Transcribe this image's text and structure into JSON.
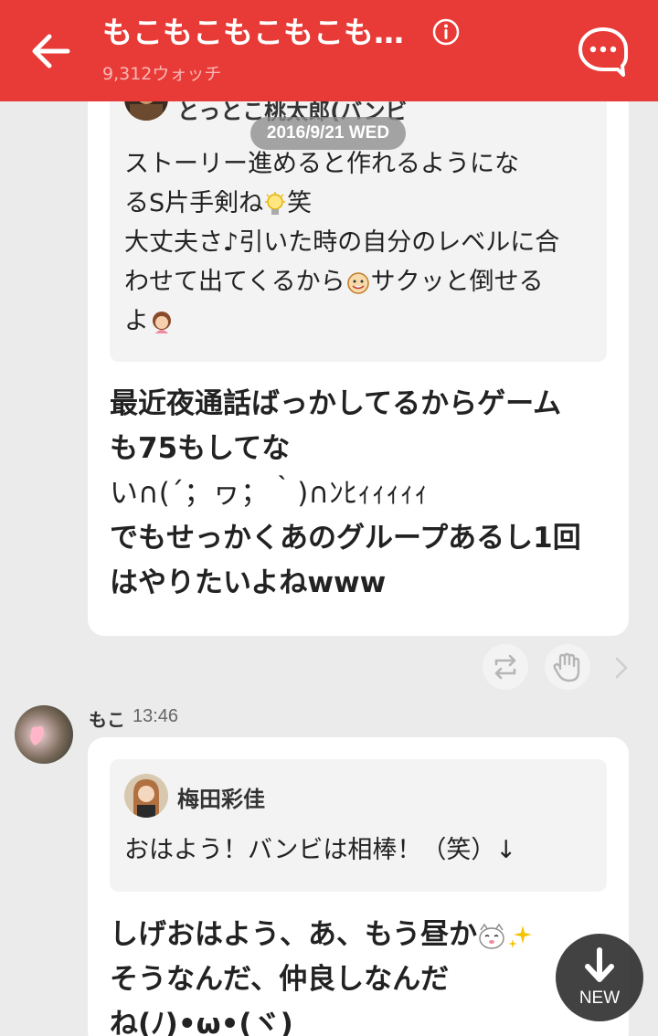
{
  "header": {
    "title": "もこもこもこもこも…",
    "subtitle": "9,312ウォッチ",
    "accent": "#e83a36"
  },
  "date_separator": "2016/9/21 WED",
  "messages": [
    {
      "quote": {
        "author": "とっとこ桃太郎(バンビ",
        "lines": [
          "ストーリー進めると作れるようにな",
          "るS片手剣ね",
          "大丈夫さ♪引いた時の自分のレベルに合",
          "わせて出てくるから",
          "よ"
        ],
        "line2_suffix": "笑",
        "line4_suffix": "サクッと倒せる"
      },
      "lines": [
        "最近夜通話ばっかしてるからゲーム",
        "も75もしてな",
        "い∩(´；ヮ；｀)∩ﾝﾋｨｨｨｨｨ",
        "でもせっかくあのグループあるし1回",
        "はやりたいよねwww"
      ]
    },
    {
      "sender": "もこ",
      "time": "13:46",
      "quote": {
        "author": "梅田彩佳",
        "text": "おはよう！バンビは相棒！（笑）↓"
      },
      "lines": [
        "しげおはよう、あ、もう昼か",
        "そうなんだ、仲良しなんだ",
        "ね(ﾉ)•ω•(ヾ)"
      ]
    }
  ],
  "actions": {
    "repost": "repost-icon",
    "clap": "clap-icon",
    "more": "chevron-right-icon"
  },
  "new_button": "NEW"
}
